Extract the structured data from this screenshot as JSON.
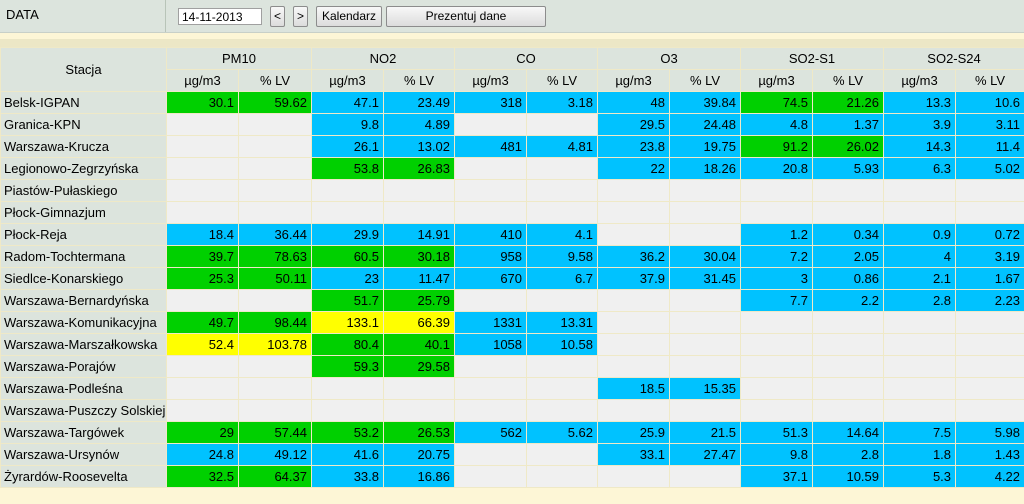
{
  "toolbar": {
    "label": "DATA",
    "date_value": "14-11-2013",
    "prev_label": "<",
    "next_label": ">",
    "calendar_label": "Kalendarz",
    "show_label": "Prezentuj dane"
  },
  "colors": {
    "green": "#00d000",
    "blue": "#00c2ff",
    "yellow": "#ffff00",
    "empty": "#f0f0f0",
    "header": "#dce4dd"
  },
  "table": {
    "station_header": "Stacja",
    "groups": [
      "PM10",
      "NO2",
      "CO",
      "O3",
      "SO2-S1",
      "SO2-S24"
    ],
    "subheaders": [
      "µg/m3",
      "% LV"
    ],
    "rows": [
      {
        "name": "Belsk-IGPAN",
        "cells": [
          [
            "30.1",
            "g"
          ],
          [
            "59.62",
            "g"
          ],
          [
            "47.1",
            "b"
          ],
          [
            "23.49",
            "b"
          ],
          [
            "318",
            "b"
          ],
          [
            "3.18",
            "b"
          ],
          [
            "48",
            "b"
          ],
          [
            "39.84",
            "b"
          ],
          [
            "74.5",
            "g"
          ],
          [
            "21.26",
            "g"
          ],
          [
            "13.3",
            "b"
          ],
          [
            "10.6",
            "b"
          ]
        ]
      },
      {
        "name": "Granica-KPN",
        "cells": [
          [
            "",
            ""
          ],
          [
            "",
            ""
          ],
          [
            "9.8",
            "b"
          ],
          [
            "4.89",
            "b"
          ],
          [
            "",
            ""
          ],
          [
            "",
            ""
          ],
          [
            "29.5",
            "b"
          ],
          [
            "24.48",
            "b"
          ],
          [
            "4.8",
            "b"
          ],
          [
            "1.37",
            "b"
          ],
          [
            "3.9",
            "b"
          ],
          [
            "3.11",
            "b"
          ]
        ]
      },
      {
        "name": "Warszawa-Krucza",
        "cells": [
          [
            "",
            ""
          ],
          [
            "",
            ""
          ],
          [
            "26.1",
            "b"
          ],
          [
            "13.02",
            "b"
          ],
          [
            "481",
            "b"
          ],
          [
            "4.81",
            "b"
          ],
          [
            "23.8",
            "b"
          ],
          [
            "19.75",
            "b"
          ],
          [
            "91.2",
            "g"
          ],
          [
            "26.02",
            "g"
          ],
          [
            "14.3",
            "b"
          ],
          [
            "11.4",
            "b"
          ]
        ]
      },
      {
        "name": "Legionowo-Zegrzyńska",
        "cells": [
          [
            "",
            ""
          ],
          [
            "",
            ""
          ],
          [
            "53.8",
            "g"
          ],
          [
            "26.83",
            "g"
          ],
          [
            "",
            ""
          ],
          [
            "",
            ""
          ],
          [
            "22",
            "b"
          ],
          [
            "18.26",
            "b"
          ],
          [
            "20.8",
            "b"
          ],
          [
            "5.93",
            "b"
          ],
          [
            "6.3",
            "b"
          ],
          [
            "5.02",
            "b"
          ]
        ]
      },
      {
        "name": "Piastów-Pułaskiego",
        "cells": [
          [
            "",
            ""
          ],
          [
            "",
            ""
          ],
          [
            "",
            ""
          ],
          [
            "",
            ""
          ],
          [
            "",
            ""
          ],
          [
            "",
            ""
          ],
          [
            "",
            ""
          ],
          [
            "",
            ""
          ],
          [
            "",
            ""
          ],
          [
            "",
            ""
          ],
          [
            "",
            ""
          ],
          [
            "",
            ""
          ]
        ]
      },
      {
        "name": "Płock-Gimnazjum",
        "cells": [
          [
            "",
            ""
          ],
          [
            "",
            ""
          ],
          [
            "",
            ""
          ],
          [
            "",
            ""
          ],
          [
            "",
            ""
          ],
          [
            "",
            ""
          ],
          [
            "",
            ""
          ],
          [
            "",
            ""
          ],
          [
            "",
            ""
          ],
          [
            "",
            ""
          ],
          [
            "",
            ""
          ],
          [
            "",
            ""
          ]
        ]
      },
      {
        "name": "Płock-Reja",
        "cells": [
          [
            "18.4",
            "b"
          ],
          [
            "36.44",
            "b"
          ],
          [
            "29.9",
            "b"
          ],
          [
            "14.91",
            "b"
          ],
          [
            "410",
            "b"
          ],
          [
            "4.1",
            "b"
          ],
          [
            "",
            ""
          ],
          [
            "",
            ""
          ],
          [
            "1.2",
            "b"
          ],
          [
            "0.34",
            "b"
          ],
          [
            "0.9",
            "b"
          ],
          [
            "0.72",
            "b"
          ]
        ]
      },
      {
        "name": "Radom-Tochtermana",
        "cells": [
          [
            "39.7",
            "g"
          ],
          [
            "78.63",
            "g"
          ],
          [
            "60.5",
            "g"
          ],
          [
            "30.18",
            "g"
          ],
          [
            "958",
            "b"
          ],
          [
            "9.58",
            "b"
          ],
          [
            "36.2",
            "b"
          ],
          [
            "30.04",
            "b"
          ],
          [
            "7.2",
            "b"
          ],
          [
            "2.05",
            "b"
          ],
          [
            "4",
            "b"
          ],
          [
            "3.19",
            "b"
          ]
        ]
      },
      {
        "name": "Siedlce-Konarskiego",
        "cells": [
          [
            "25.3",
            "g"
          ],
          [
            "50.11",
            "g"
          ],
          [
            "23",
            "b"
          ],
          [
            "11.47",
            "b"
          ],
          [
            "670",
            "b"
          ],
          [
            "6.7",
            "b"
          ],
          [
            "37.9",
            "b"
          ],
          [
            "31.45",
            "b"
          ],
          [
            "3",
            "b"
          ],
          [
            "0.86",
            "b"
          ],
          [
            "2.1",
            "b"
          ],
          [
            "1.67",
            "b"
          ]
        ]
      },
      {
        "name": "Warszawa-Bernardyńska",
        "cells": [
          [
            "",
            ""
          ],
          [
            "",
            ""
          ],
          [
            "51.7",
            "g"
          ],
          [
            "25.79",
            "g"
          ],
          [
            "",
            ""
          ],
          [
            "",
            ""
          ],
          [
            "",
            ""
          ],
          [
            "",
            ""
          ],
          [
            "7.7",
            "b"
          ],
          [
            "2.2",
            "b"
          ],
          [
            "2.8",
            "b"
          ],
          [
            "2.23",
            "b"
          ]
        ]
      },
      {
        "name": "Warszawa-Komunikacyjna",
        "cells": [
          [
            "49.7",
            "g"
          ],
          [
            "98.44",
            "g"
          ],
          [
            "133.1",
            "y"
          ],
          [
            "66.39",
            "y"
          ],
          [
            "1331",
            "b"
          ],
          [
            "13.31",
            "b"
          ],
          [
            "",
            ""
          ],
          [
            "",
            ""
          ],
          [
            "",
            ""
          ],
          [
            "",
            ""
          ],
          [
            "",
            ""
          ],
          [
            "",
            ""
          ]
        ]
      },
      {
        "name": "Warszawa-Marszałkowska",
        "cells": [
          [
            "52.4",
            "y"
          ],
          [
            "103.78",
            "y"
          ],
          [
            "80.4",
            "g"
          ],
          [
            "40.1",
            "g"
          ],
          [
            "1058",
            "b"
          ],
          [
            "10.58",
            "b"
          ],
          [
            "",
            ""
          ],
          [
            "",
            ""
          ],
          [
            "",
            ""
          ],
          [
            "",
            ""
          ],
          [
            "",
            ""
          ],
          [
            "",
            ""
          ]
        ]
      },
      {
        "name": "Warszawa-Porajów",
        "cells": [
          [
            "",
            ""
          ],
          [
            "",
            ""
          ],
          [
            "59.3",
            "g"
          ],
          [
            "29.58",
            "g"
          ],
          [
            "",
            ""
          ],
          [
            "",
            ""
          ],
          [
            "",
            ""
          ],
          [
            "",
            ""
          ],
          [
            "",
            ""
          ],
          [
            "",
            ""
          ],
          [
            "",
            ""
          ],
          [
            "",
            ""
          ]
        ]
      },
      {
        "name": "Warszawa-Podleśna",
        "cells": [
          [
            "",
            ""
          ],
          [
            "",
            ""
          ],
          [
            "",
            ""
          ],
          [
            "",
            ""
          ],
          [
            "",
            ""
          ],
          [
            "",
            ""
          ],
          [
            "18.5",
            "b"
          ],
          [
            "15.35",
            "b"
          ],
          [
            "",
            ""
          ],
          [
            "",
            ""
          ],
          [
            "",
            ""
          ],
          [
            "",
            ""
          ]
        ]
      },
      {
        "name": "Warszawa-Puszczy Solskiej",
        "cells": [
          [
            "",
            ""
          ],
          [
            "",
            ""
          ],
          [
            "",
            ""
          ],
          [
            "",
            ""
          ],
          [
            "",
            ""
          ],
          [
            "",
            ""
          ],
          [
            "",
            ""
          ],
          [
            "",
            ""
          ],
          [
            "",
            ""
          ],
          [
            "",
            ""
          ],
          [
            "",
            ""
          ],
          [
            "",
            ""
          ]
        ]
      },
      {
        "name": "Warszawa-Targówek",
        "cells": [
          [
            "29",
            "g"
          ],
          [
            "57.44",
            "g"
          ],
          [
            "53.2",
            "g"
          ],
          [
            "26.53",
            "g"
          ],
          [
            "562",
            "b"
          ],
          [
            "5.62",
            "b"
          ],
          [
            "25.9",
            "b"
          ],
          [
            "21.5",
            "b"
          ],
          [
            "51.3",
            "b"
          ],
          [
            "14.64",
            "b"
          ],
          [
            "7.5",
            "b"
          ],
          [
            "5.98",
            "b"
          ]
        ]
      },
      {
        "name": "Warszawa-Ursynów",
        "cells": [
          [
            "24.8",
            "b"
          ],
          [
            "49.12",
            "b"
          ],
          [
            "41.6",
            "b"
          ],
          [
            "20.75",
            "b"
          ],
          [
            "",
            ""
          ],
          [
            "",
            ""
          ],
          [
            "33.1",
            "b"
          ],
          [
            "27.47",
            "b"
          ],
          [
            "9.8",
            "b"
          ],
          [
            "2.8",
            "b"
          ],
          [
            "1.8",
            "b"
          ],
          [
            "1.43",
            "b"
          ]
        ]
      },
      {
        "name": "Żyrardów-Roosevelta",
        "cells": [
          [
            "32.5",
            "g"
          ],
          [
            "64.37",
            "g"
          ],
          [
            "33.8",
            "b"
          ],
          [
            "16.86",
            "b"
          ],
          [
            "",
            ""
          ],
          [
            "",
            ""
          ],
          [
            "",
            ""
          ],
          [
            "",
            ""
          ],
          [
            "37.1",
            "b"
          ],
          [
            "10.59",
            "b"
          ],
          [
            "5.3",
            "b"
          ],
          [
            "4.22",
            "b"
          ]
        ]
      }
    ]
  }
}
